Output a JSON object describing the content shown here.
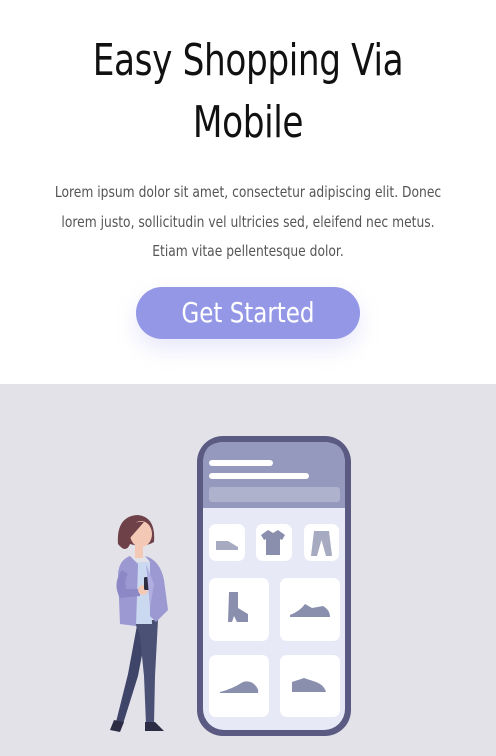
{
  "hero": {
    "title_line1": "Easy Shopping Via",
    "title_line2": "Mobile",
    "description_lines": [
      "Lorem ipsum dolor sit amet, consectetur adipiscing elit. Donec",
      "lorem justo, sollicitudin vel ultricies sed, eleifend nec metus.",
      "Etiam vitae pellentesque dolor."
    ],
    "cta_label": "Get Started"
  },
  "illustration": {
    "icons": [
      "shoe-icon",
      "tshirt-icon",
      "pants-icon",
      "boot-icon",
      "sneaker-icon",
      "flat-shoe-icon",
      "loafer-icon"
    ],
    "colors": {
      "accent": "#9397e6",
      "phone_frame": "#5a5a82",
      "phone_screen": "#e8e9f7",
      "background": "#e3e2e9"
    }
  }
}
